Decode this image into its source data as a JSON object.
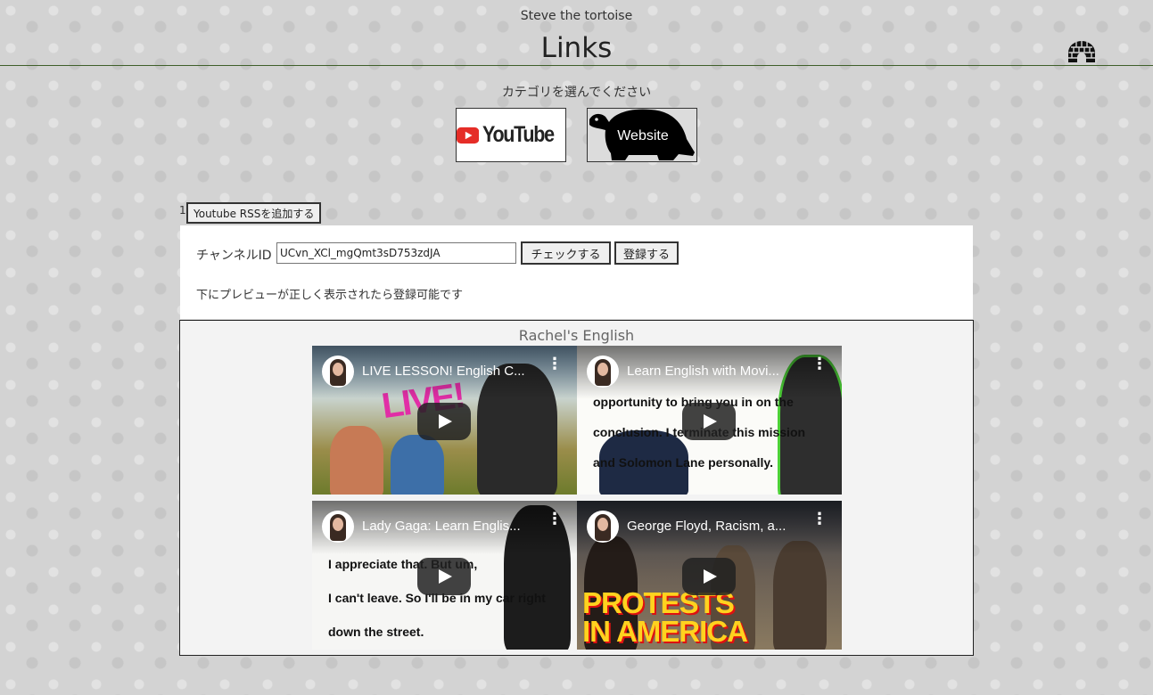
{
  "header": {
    "site_name": "Steve the tortoise",
    "title": "Links",
    "home_icon": "igloo-icon"
  },
  "category": {
    "prompt": "カテゴリを選んでください",
    "youtube_label": "YouTube",
    "website_label": "Website"
  },
  "rss": {
    "counter": "1",
    "add_button": "Youtube RSSを追加する",
    "channel_id_label": "チャンネルID",
    "channel_id_value": "UCvn_XCl_mgQmt3sD753zdJA",
    "check_button": "チェックする",
    "register_button": "登録する",
    "note": "下にプレビューが正しく表示されたら登録可能です"
  },
  "preview": {
    "channel_name": "Rachel's English",
    "videos": [
      {
        "title": "LIVE LESSON! English C..."
      },
      {
        "title": "Learn English with Movi..."
      },
      {
        "title": "Lady Gaga: Learn Englis..."
      },
      {
        "title": "George Floyd, Racism, a..."
      }
    ]
  },
  "thumbnail_text": {
    "live": "LIVE!",
    "movie_caption_1": "opportunity to bring you in on the",
    "movie_caption_2": "conclusion. I terminate this mission",
    "movie_caption_3": "and Solomon Lane personally.",
    "gaga_caption_1": "I appreciate that.  But um,",
    "gaga_caption_2": "I can't leave.  So I'll be in my car right",
    "gaga_caption_3": "down the street.",
    "protest_line_1": "PROTESTS",
    "protest_line_2": "IN AMERICA"
  }
}
